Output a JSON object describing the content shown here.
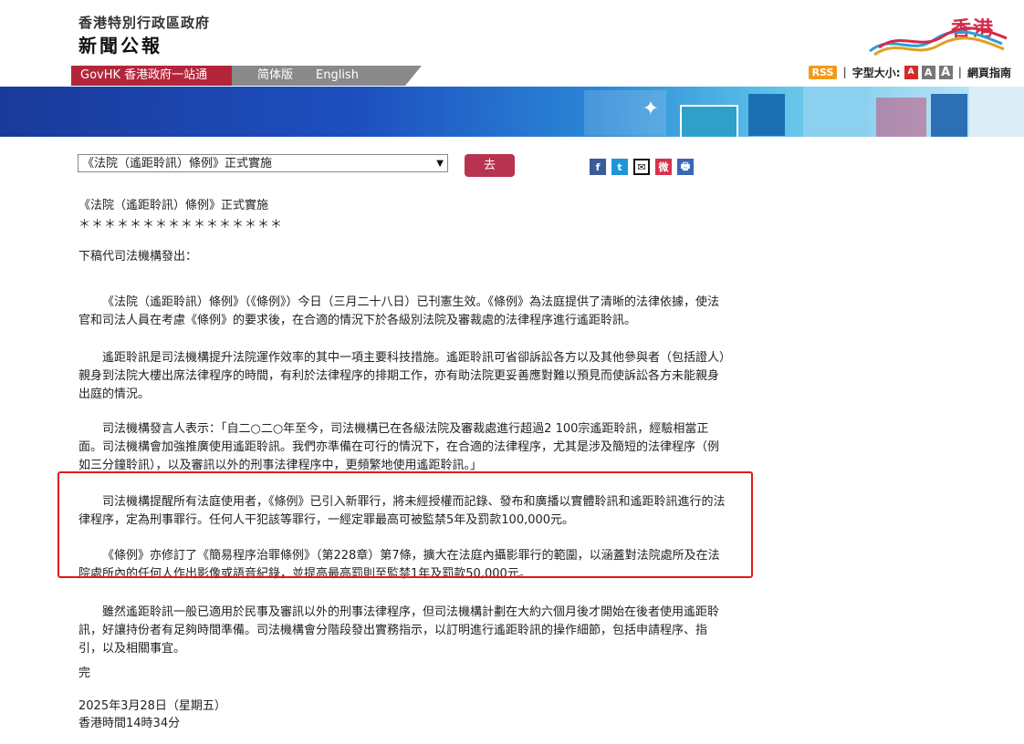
{
  "header": {
    "gov_name": "香港特別行政區政府",
    "site_name": "新聞公報",
    "brand": "香港"
  },
  "nav": {
    "govhk": "GovHK 香港政府一站通",
    "simplified": "简体版",
    "english": "English"
  },
  "tools": {
    "rss": "RSS",
    "font_size_label": "字型大小:",
    "font_small": "A",
    "font_medium": "A",
    "font_large": "A",
    "guide": "網頁指南"
  },
  "selector": {
    "value": "《法院（遙距聆訊）條例》正式實施",
    "go_label": "去"
  },
  "share": {
    "facebook": "f",
    "twitter": "t",
    "email": "✉",
    "weibo": "微",
    "print": "🖶"
  },
  "article": {
    "title": "《法院（遙距聆訊）條例》正式實施",
    "stars": "＊＊＊＊＊＊＊＊＊＊＊＊＊＊＊＊",
    "lead": "下稿代司法機構發出：",
    "paragraphs": [
      "《法院（遙距聆訊）條例》（《條例》）今日（三月二十八日）已刊憲生效。《條例》為法庭提供了清晰的法律依據，使法官和司法人員在考慮《條例》的要求後，在合適的情況下於各級別法院及審裁處的法律程序進行遙距聆訊。",
      "遙距聆訊是司法機構提升法院運作效率的其中一項主要科技措施。遙距聆訊可省卻訴訟各方以及其他參與者（包括證人）親身到法院大樓出席法律程序的時間，有利於法律程序的排期工作，亦有助法院更妥善應對難以預見而使訴訟各方未能親身出庭的情況。",
      "司法機構發言人表示：「自二○二○年至今，司法機構已在各級法院及審裁處進行超過2 100宗遙距聆訊，經驗相當正面。司法機構會加強推廣使用遙距聆訊。我們亦準備在可行的情況下，在合適的法律程序，尤其是涉及簡短的法律程序（例如三分鐘聆訊），以及審訊以外的刑事法律程序中，更頻繁地使用遙距聆訊。」",
      "司法機構提醒所有法庭使用者，《條例》已引入新罪行，將未經授權而記錄、發布和廣播以實體聆訊和遙距聆訊進行的法律程序，定為刑事罪行。任何人干犯該等罪行，一經定罪最高可被監禁5年及罰款100,000元。",
      "《條例》亦修訂了《簡易程序治罪條例》（第228章）第7條，擴大在法庭內攝影罪行的範圍，以涵蓋對法院處所及在法院處所內的任何人作出影像或語音紀錄，並提高最高罰則至監禁1年及罰款50,000元。",
      "雖然遙距聆訊一般已適用於民事及審訊以外的刑事法律程序，但司法機構計劃在大約六個月後才開始在後者使用遙距聆訊，好讓持份者有足夠時間準備。司法機構會分階段發出實務指示，以訂明進行遙距聆訊的操作細節，包括申請程序、指引，以及相關事宜。"
    ],
    "end": "完",
    "date": "2025年3月28日（星期五）",
    "time": "香港時間14時34分"
  },
  "colors": {
    "brand_red": "#b3263a",
    "go_button": "#b8334f",
    "highlight_border": "#e01a1a"
  }
}
